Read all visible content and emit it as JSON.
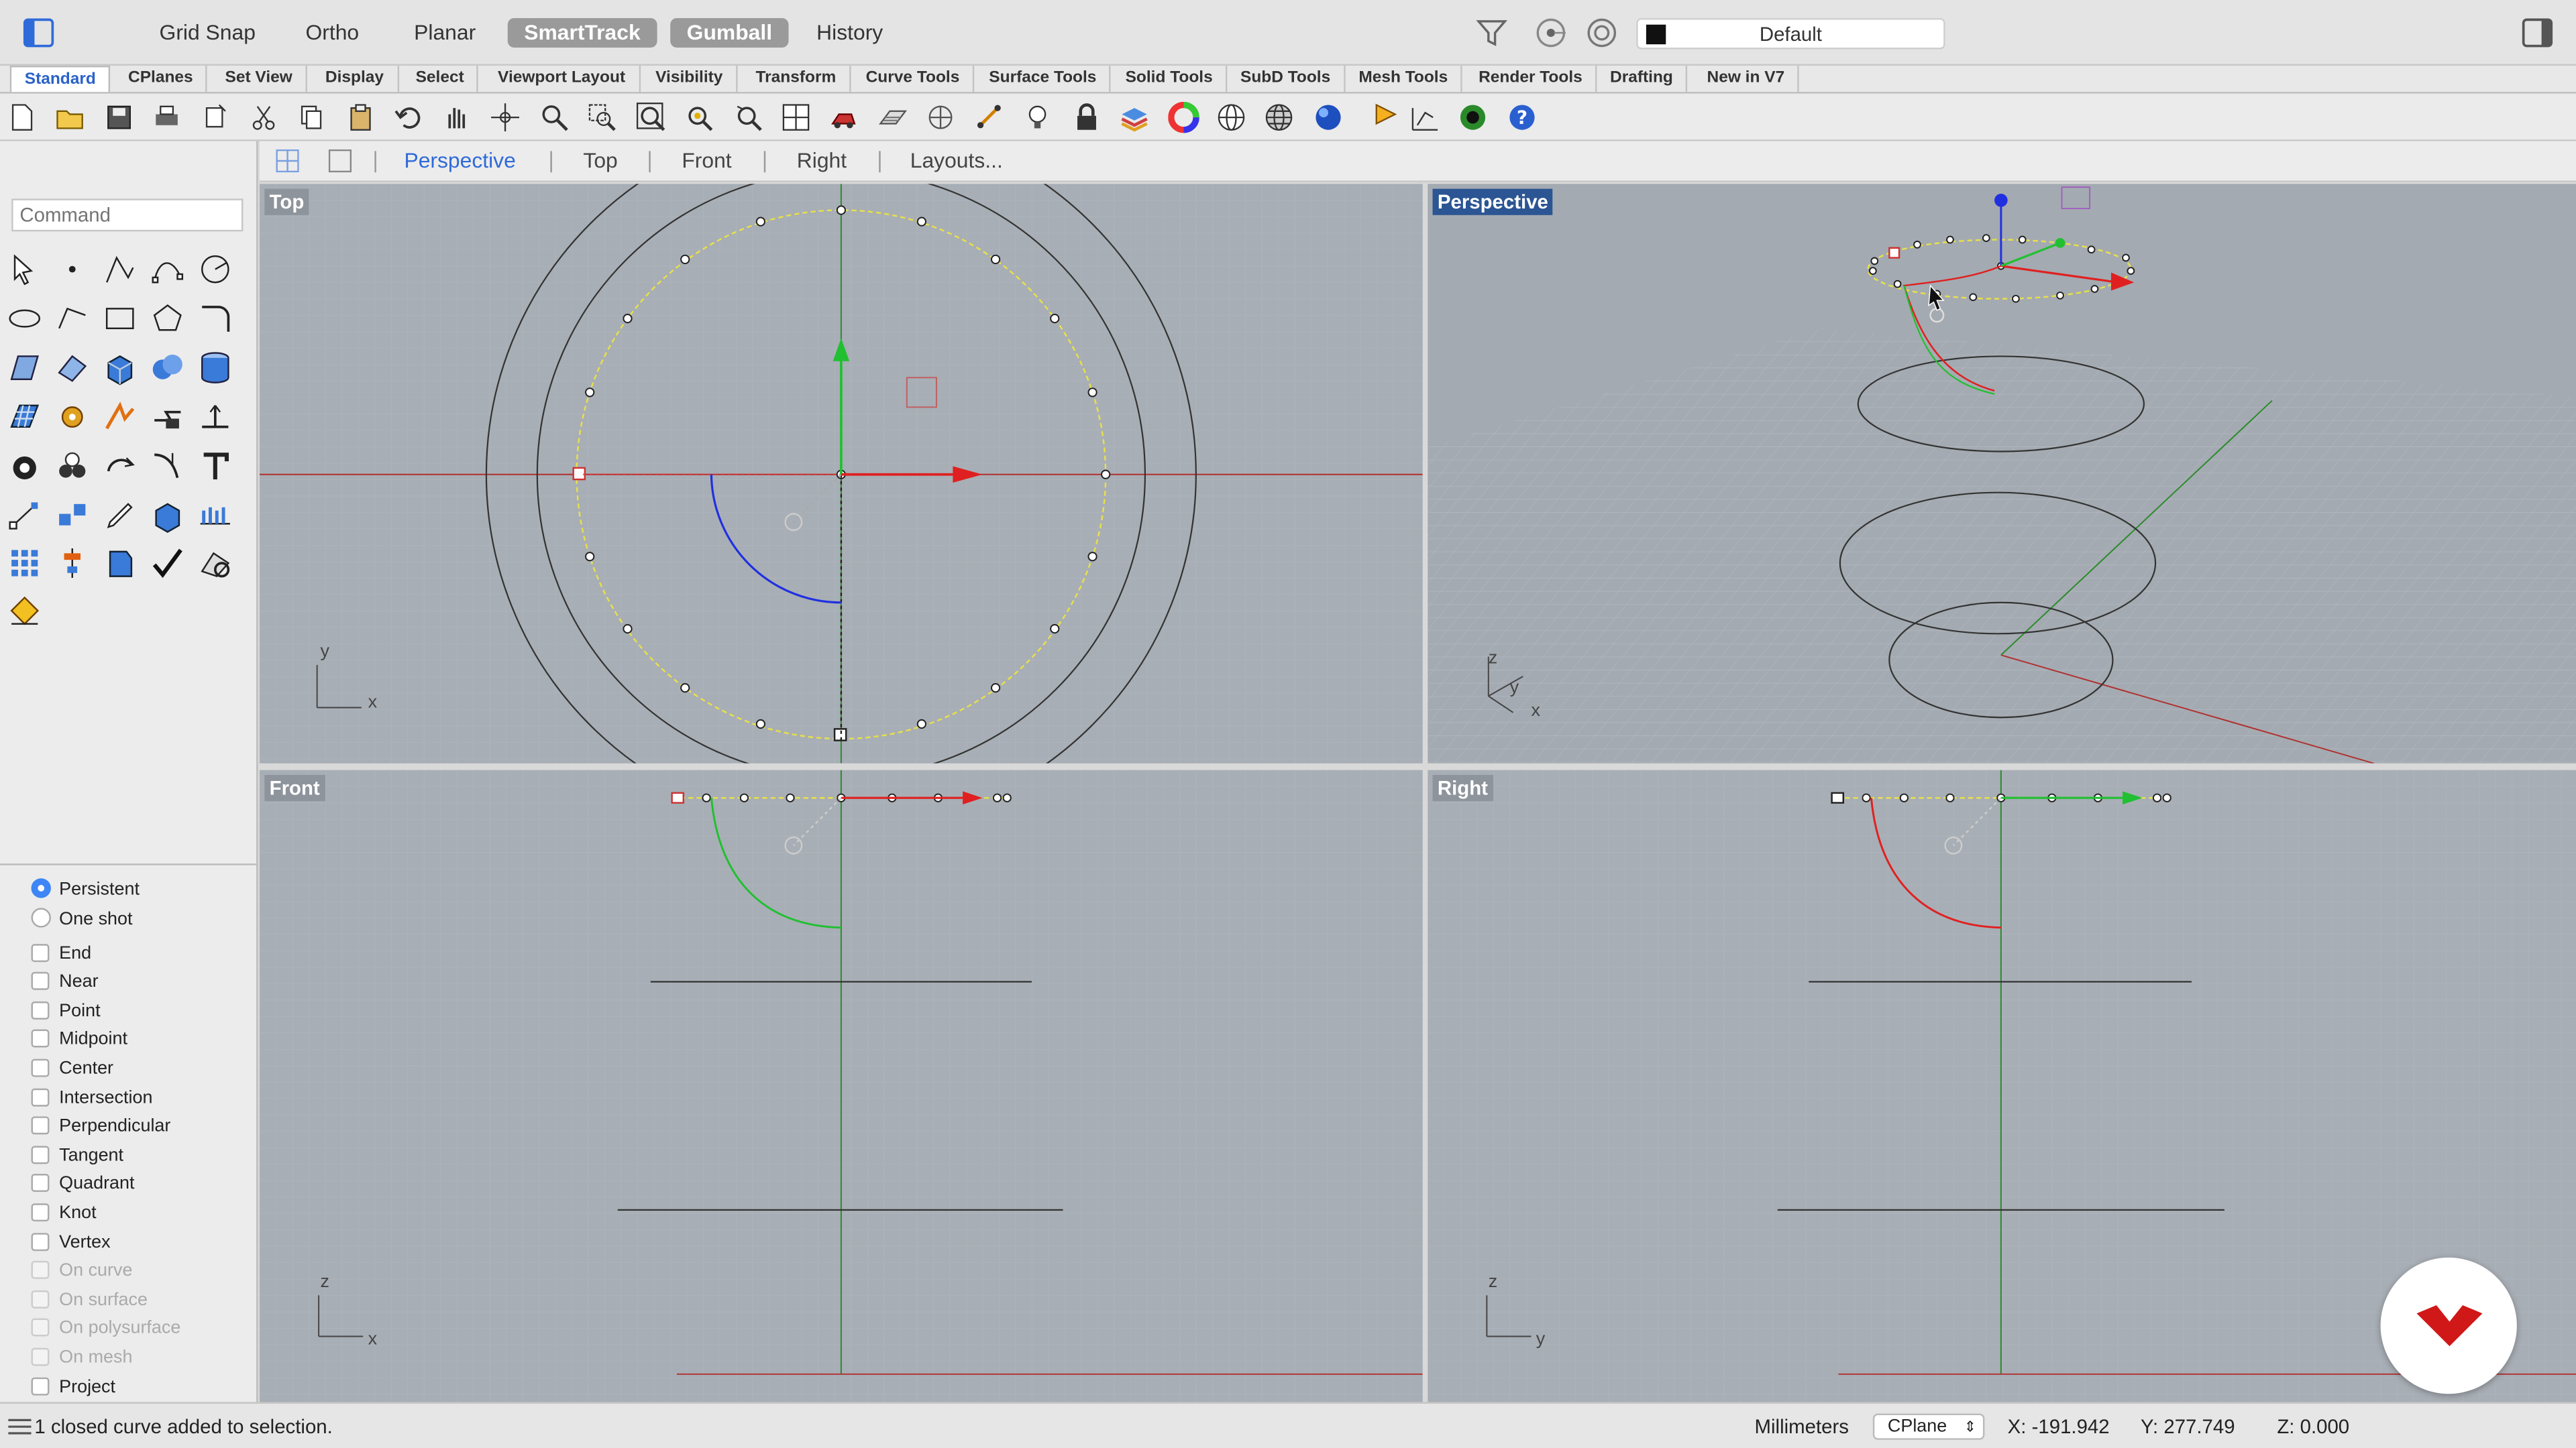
{
  "topbar": {
    "grid_snap": "Grid Snap",
    "ortho": "Ortho",
    "planar": "Planar",
    "smarttrack": "SmartTrack",
    "gumball": "Gumball",
    "history": "History",
    "layer": "Default"
  },
  "tabs": [
    "Standard",
    "CPlanes",
    "Set View",
    "Display",
    "Select",
    "Viewport Layout",
    "Visibility",
    "Transform",
    "Curve Tools",
    "Surface Tools",
    "Solid Tools",
    "SubD Tools",
    "Mesh Tools",
    "Render Tools",
    "Drafting",
    "New in V7"
  ],
  "viewport_tabs": {
    "perspective": "Perspective",
    "top": "Top",
    "front": "Front",
    "right": "Right",
    "layouts": "Layouts..."
  },
  "command": {
    "placeholder": "Command"
  },
  "snaps": {
    "persistent": "Persistent",
    "one_shot": "One shot",
    "items": [
      "End",
      "Near",
      "Point",
      "Midpoint",
      "Center",
      "Intersection",
      "Perpendicular",
      "Tangent",
      "Quadrant",
      "Knot",
      "Vertex"
    ],
    "disabled_items": [
      "On curve",
      "On surface",
      "On polysurface",
      "On mesh"
    ],
    "project": "Project"
  },
  "viewports": {
    "top": "Top",
    "perspective": "Perspective",
    "front": "Front",
    "right": "Right",
    "axis_x": "x",
    "axis_y": "y",
    "axis_z": "z"
  },
  "status": {
    "message": "1 closed curve added to selection.",
    "units": "Millimeters",
    "cplane": "CPlane",
    "x": "X: -191.942",
    "y": "Y: 277.749",
    "z": "Z: 0.000"
  },
  "colors": {
    "accent": "#2f6ad9",
    "x_axis": "#e02020",
    "y_axis": "#20c030",
    "z_axis": "#2030e0",
    "selected_curve": "#e8e04a"
  }
}
